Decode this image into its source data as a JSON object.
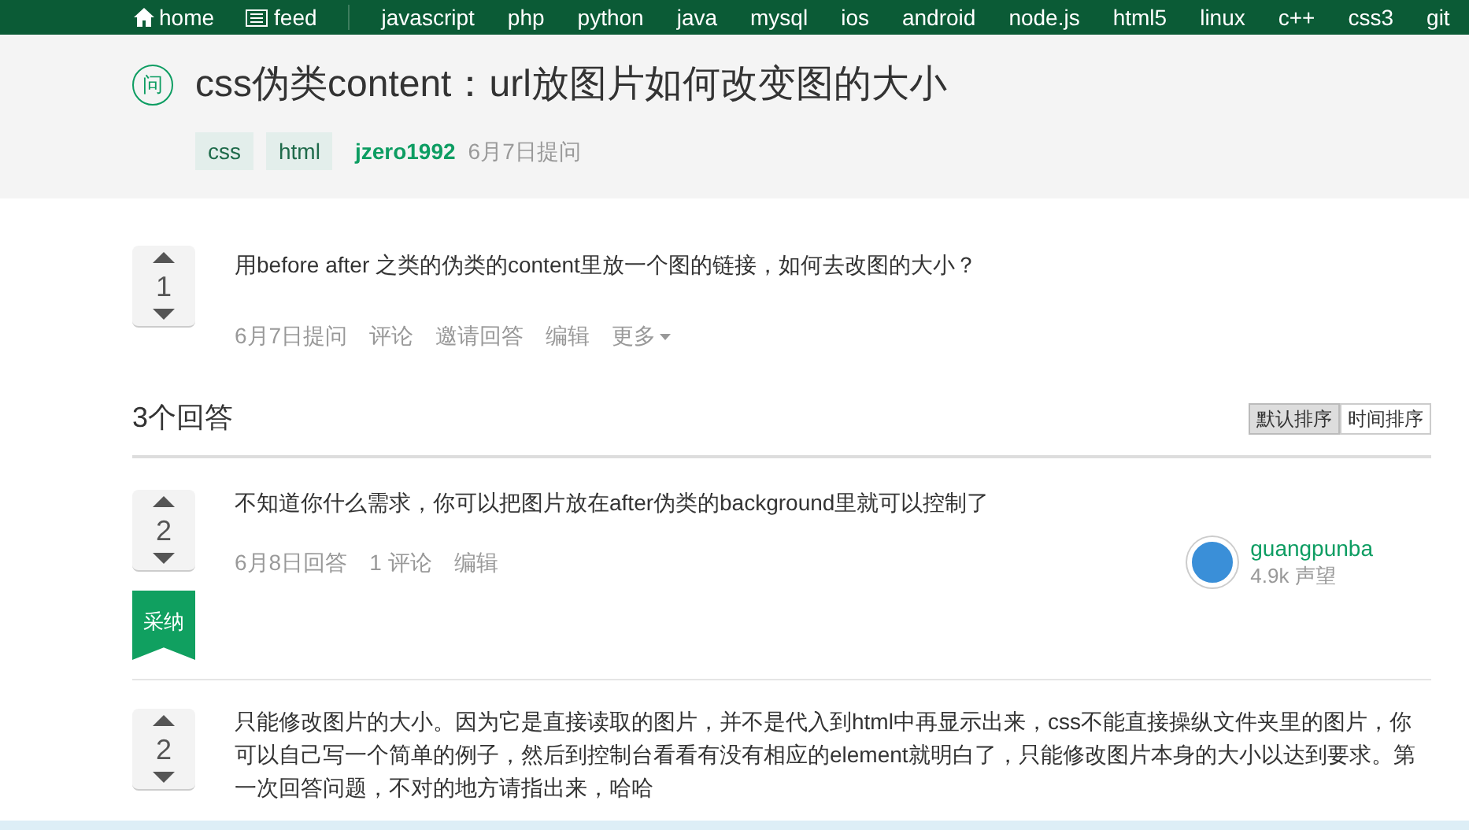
{
  "nav": {
    "home": "home",
    "feed": "feed",
    "tags": [
      "javascript",
      "php",
      "python",
      "java",
      "mysql",
      "ios",
      "android",
      "node.js",
      "html5",
      "linux",
      "c++",
      "css3",
      "git"
    ]
  },
  "question": {
    "badge": "问",
    "title": "css伪类content：url放图片如何改变图的大小",
    "tags": [
      "css",
      "html"
    ],
    "author": "jzero1992",
    "asked": "6月7日提问",
    "votes": "1",
    "body": "用before after 之类的伪类的content里放一个图的链接，如何去改图的大小？",
    "actions": [
      "6月7日提问",
      "评论",
      "邀请回答",
      "编辑"
    ],
    "more": "更多"
  },
  "answers_header": {
    "count": "3个回答",
    "sorts": [
      {
        "label": "默认排序",
        "selected": true
      },
      {
        "label": "时间排序",
        "selected": false
      }
    ]
  },
  "answers": [
    {
      "votes": "2",
      "accepted": true,
      "accepted_label": "采纳",
      "body": "不知道你什么需求，你可以把图片放在after伪类的background里就可以控制了",
      "actions": [
        "6月8日回答",
        "1 评论",
        "编辑"
      ],
      "user": {
        "name": "guangpunba",
        "reputation": "4.9k 声望"
      }
    },
    {
      "votes": "2",
      "accepted": false,
      "body": "只能修改图片的大小。因为它是直接读取的图片，并不是代入到html中再显示出来，css不能直接操纵文件夹里的图片，你可以自己写一个简单的例子，然后到控制台看看有没有相应的element就明白了，只能修改图片本身的大小以达到要求。第一次回答问题，不对的地方请指出来，哈哈"
    }
  ]
}
